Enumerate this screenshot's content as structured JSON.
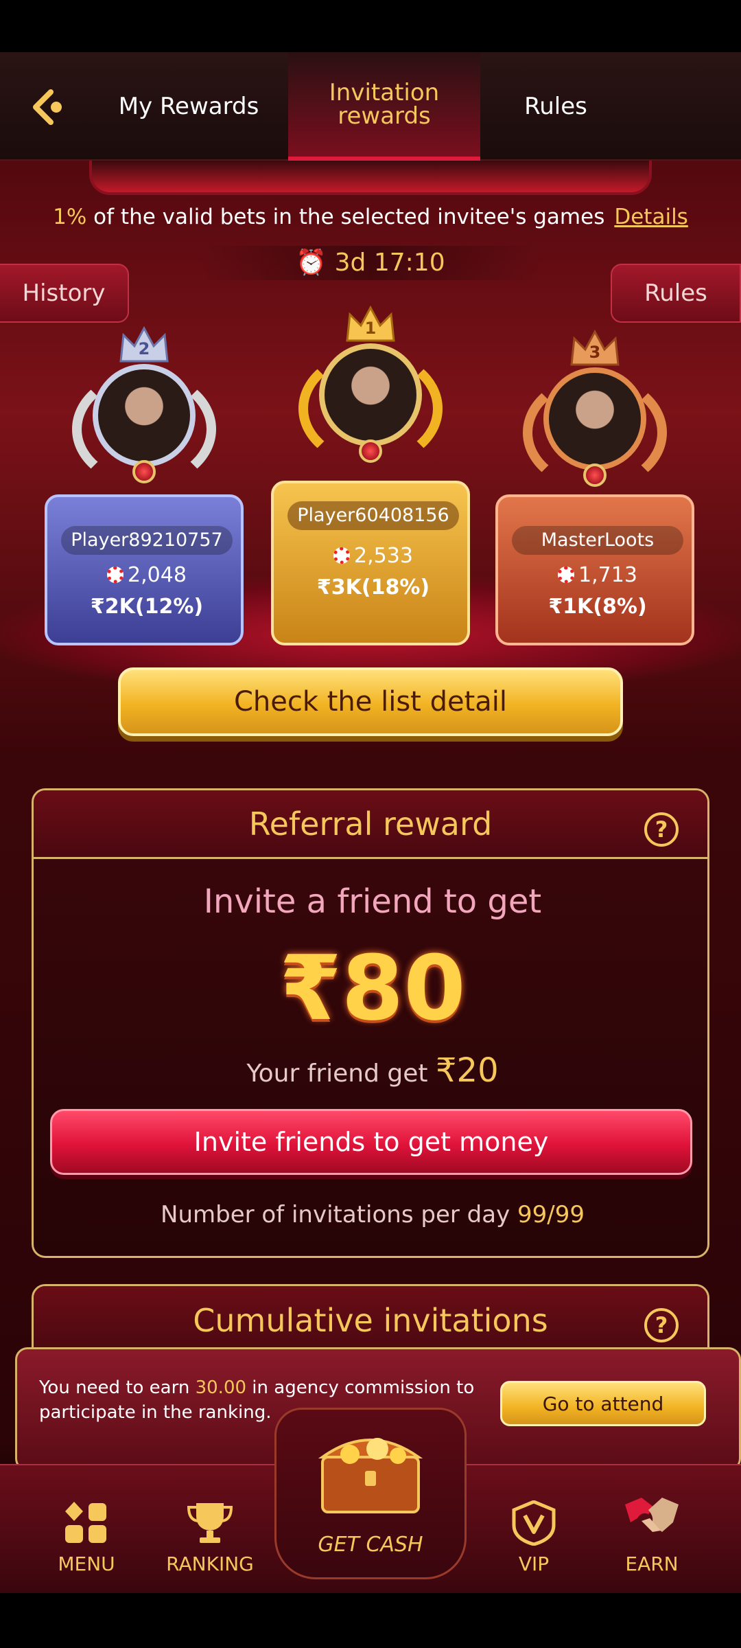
{
  "topbar": {
    "tabs": [
      "My Rewards",
      "Invitation\nrewards",
      "Rules"
    ]
  },
  "banner": {
    "desc_percent": "1%",
    "desc_text": " of the valid bets in the selected invitee's games",
    "details_label": "Details",
    "timer": "3d 17:10",
    "history_label": "History",
    "rules_label": "Rules"
  },
  "podium": [
    {
      "rank": "2",
      "name": "Player89210757",
      "score": "2,048",
      "reward": "₹2K(12%)"
    },
    {
      "rank": "1",
      "name": "Player60408156",
      "score": "2,533",
      "reward": "₹3K(18%)"
    },
    {
      "rank": "3",
      "name": "MasterLoots",
      "score": "1,713",
      "reward": "₹1K(8%)"
    }
  ],
  "check_list_label": "Check the list detail",
  "referral": {
    "title": "Referral reward",
    "invite_line": "Invite a friend to get",
    "amount": "₹80",
    "friend_prefix": "Your friend get ",
    "friend_amount": "₹20",
    "invite_button": "Invite friends to get money",
    "per_day_prefix": "Number of invitations per day ",
    "per_day_count": "99/99"
  },
  "cumulative": {
    "title": "Cumulative invitations"
  },
  "notice": {
    "prefix": "You need to earn ",
    "value": "30.00",
    "suffix": " in agency commission to participate in the ranking.",
    "button": "Go to attend"
  },
  "nav": {
    "menu": "MENU",
    "ranking": "RANKING",
    "get_cash": "GET CASH",
    "vip": "VIP",
    "earn": "EARN"
  },
  "colors": {
    "accent_gold": "#f6c75b",
    "accent_red": "#e0123a",
    "background": "#5a0a10"
  }
}
